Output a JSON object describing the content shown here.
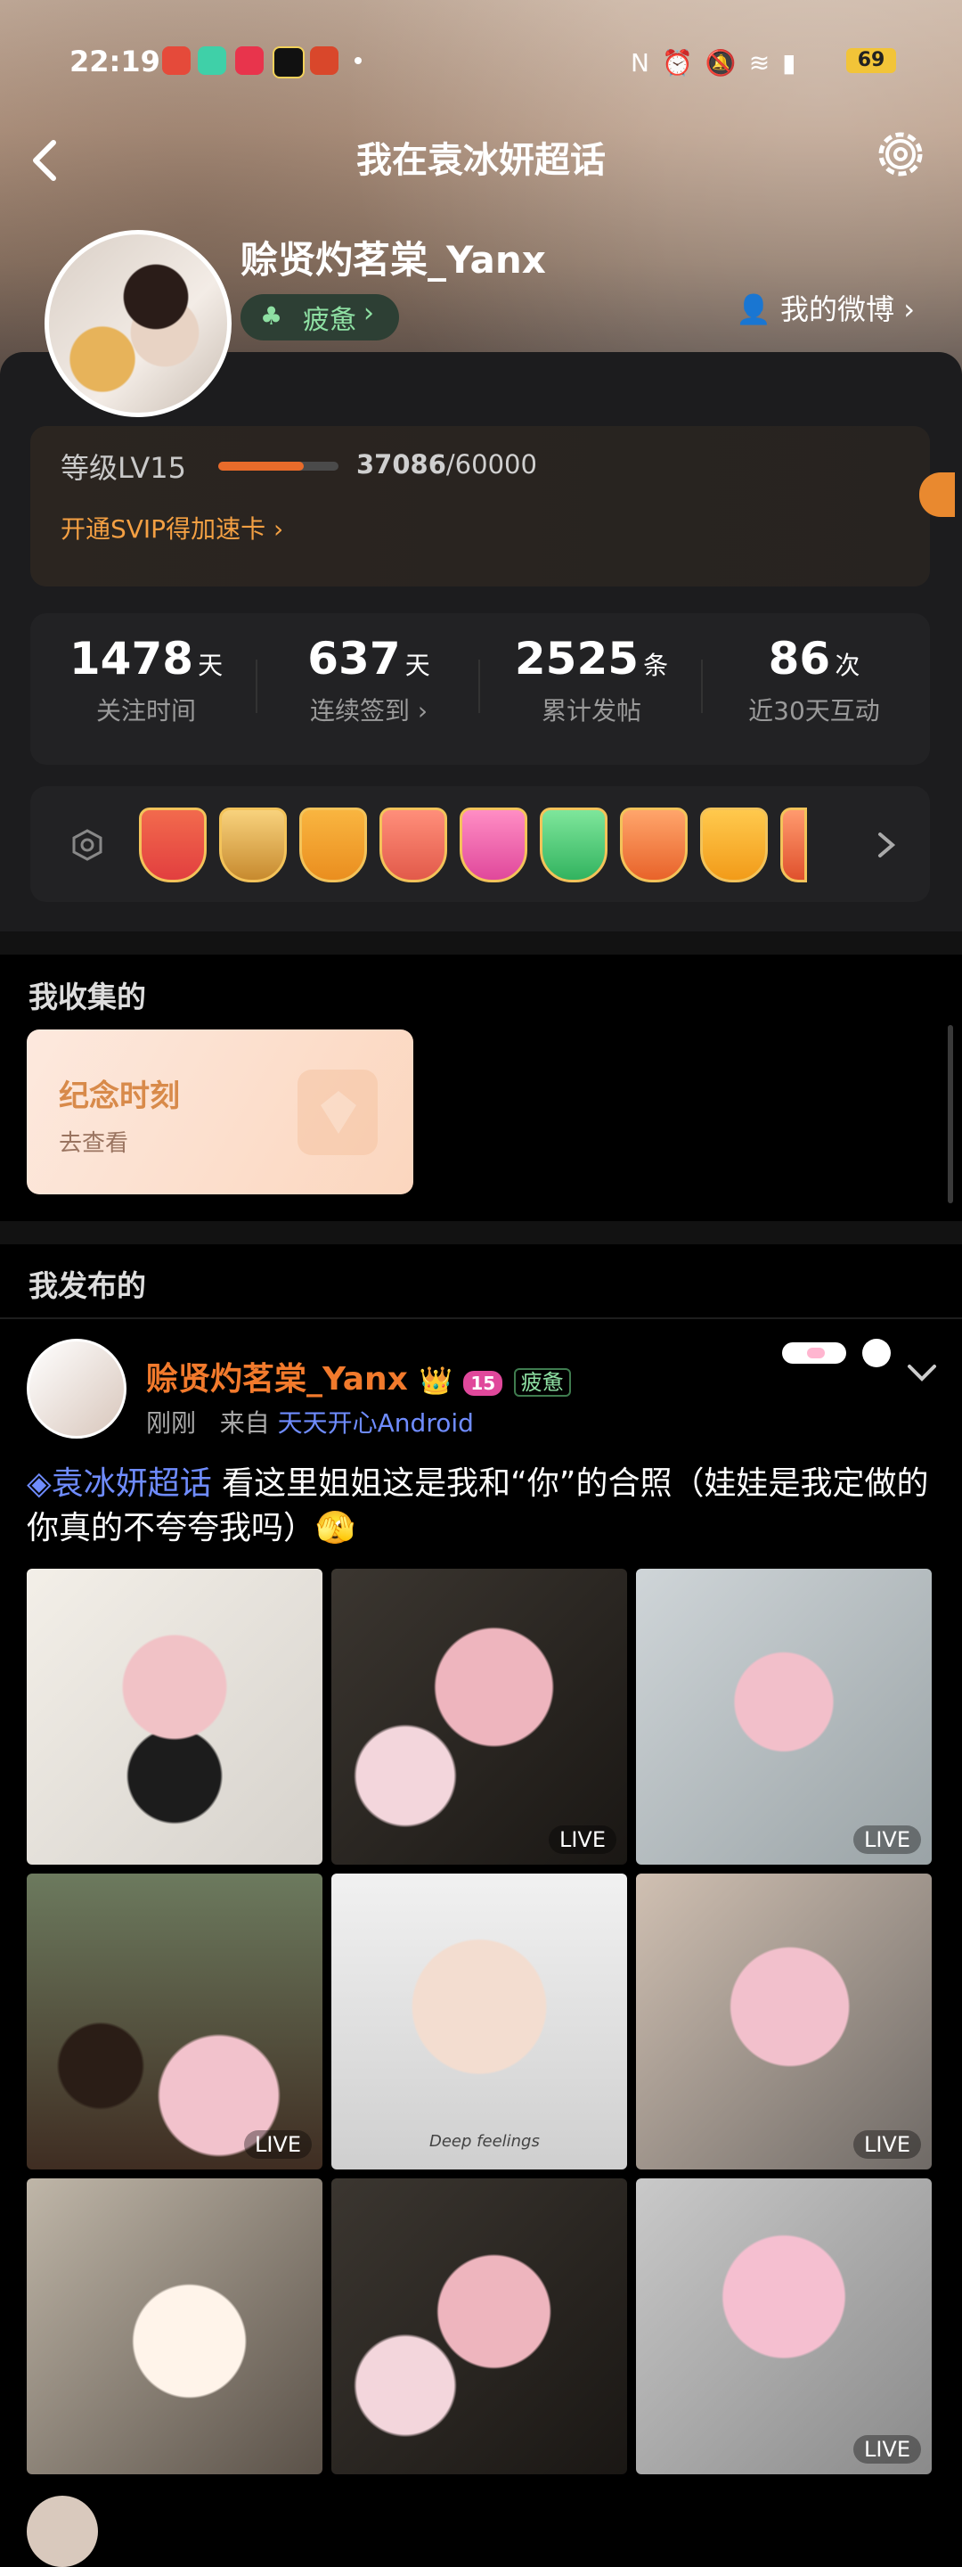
{
  "status_bar": {
    "time": "22:19",
    "battery": "69"
  },
  "header": {
    "title": "我在袁冰妍超话"
  },
  "profile": {
    "username": "赊贤灼茗棠_Yanx",
    "status": "疲惫",
    "my_weibo": "我的微博"
  },
  "level": {
    "label": "等级LV15",
    "current": "37086",
    "max": "/60000",
    "svip": "开通SVIP得加速卡",
    "progress": 0.62
  },
  "stats": [
    {
      "num": "1478",
      "unit": "天",
      "label": "关注时间"
    },
    {
      "num": "637",
      "unit": "天",
      "label": "连续签到"
    },
    {
      "num": "2525",
      "unit": "条",
      "label": "累计发帖"
    },
    {
      "num": "86",
      "unit": "次",
      "label": "近30天互动"
    }
  ],
  "collection": {
    "title": "我收集的",
    "card_title": "纪念时刻",
    "card_sub": "去查看"
  },
  "published": {
    "title": "我发布的"
  },
  "post": {
    "username": "赊贤灼茗棠_Yanx",
    "level_badge": "15",
    "status": "疲惫",
    "time": "刚刚",
    "from": "来自",
    "client": "天天开心Android",
    "tag": "袁冰妍超话",
    "text": " 看这里姐姐这是我和“你”的合照（娃娃是我定做的你真的不夸夸我吗）🫣",
    "live": "LIVE"
  },
  "colors": {
    "accent_orange": "#f27a2c",
    "link_blue": "#6f8cff"
  }
}
